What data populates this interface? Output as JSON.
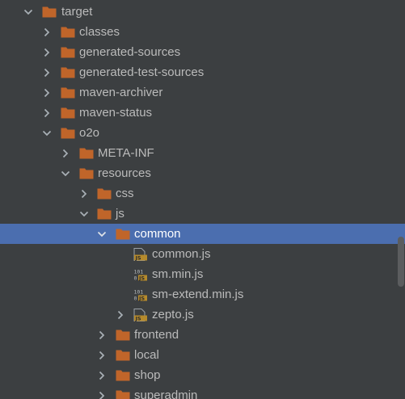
{
  "tree": {
    "rows": [
      {
        "label": "target",
        "kind": "folder",
        "chevron": "down",
        "selected": false
      },
      {
        "label": "classes",
        "kind": "folder",
        "chevron": "right",
        "selected": false
      },
      {
        "label": "generated-sources",
        "kind": "folder",
        "chevron": "right",
        "selected": false
      },
      {
        "label": "generated-test-sources",
        "kind": "folder",
        "chevron": "right",
        "selected": false
      },
      {
        "label": "maven-archiver",
        "kind": "folder",
        "chevron": "right",
        "selected": false
      },
      {
        "label": "maven-status",
        "kind": "folder",
        "chevron": "right",
        "selected": false
      },
      {
        "label": "o2o",
        "kind": "folder",
        "chevron": "down",
        "selected": false
      },
      {
        "label": "META-INF",
        "kind": "folder",
        "chevron": "right",
        "selected": false
      },
      {
        "label": "resources",
        "kind": "folder",
        "chevron": "down",
        "selected": false
      },
      {
        "label": "css",
        "kind": "folder",
        "chevron": "right",
        "selected": false
      },
      {
        "label": "js",
        "kind": "folder",
        "chevron": "down",
        "selected": false
      },
      {
        "label": "common",
        "kind": "folder",
        "chevron": "down",
        "selected": true
      },
      {
        "label": "common.js",
        "kind": "js-file",
        "chevron": "none",
        "selected": false
      },
      {
        "label": "sm.min.js",
        "kind": "min-js-file",
        "chevron": "none",
        "selected": false
      },
      {
        "label": "sm-extend.min.js",
        "kind": "min-js-file",
        "chevron": "none",
        "selected": false
      },
      {
        "label": "zepto.js",
        "kind": "js-file",
        "chevron": "right",
        "selected": false
      },
      {
        "label": "frontend",
        "kind": "folder",
        "chevron": "right",
        "selected": false
      },
      {
        "label": "local",
        "kind": "folder",
        "chevron": "right",
        "selected": false
      },
      {
        "label": "shop",
        "kind": "folder",
        "chevron": "right",
        "selected": false
      },
      {
        "label": "superadmin",
        "kind": "folder",
        "chevron": "right",
        "selected": false
      }
    ]
  },
  "colors": {
    "background": "#3c3f41",
    "selection": "#4b6eaf",
    "text": "#bbbbbb",
    "folder": "#c0652a",
    "js_badge": "#b58a2c"
  }
}
